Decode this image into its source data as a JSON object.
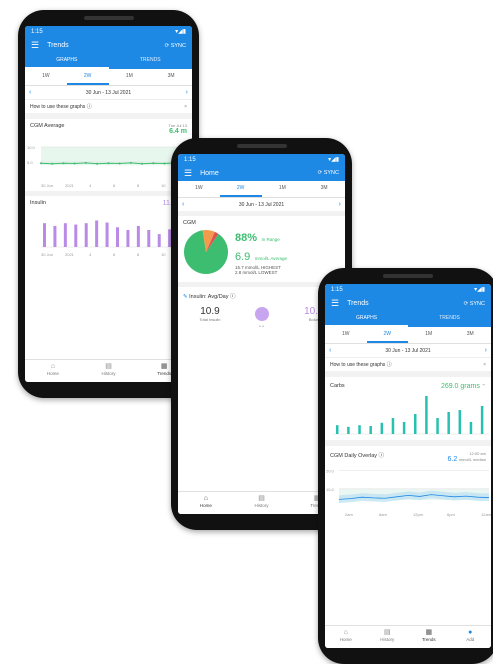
{
  "phone1": {
    "status_time": "1:15",
    "title": "Trends",
    "sync": "SYNC",
    "tabs": [
      "GRAPHS",
      "TRENDS"
    ],
    "ranges": [
      "1W",
      "2W",
      "1M",
      "3M"
    ],
    "date_range": "30 Jun - 13 Jul 2021",
    "howto": "How to use these graphs",
    "cgm_label": "CGM Average",
    "cgm_date": "Tue Jul 13",
    "cgm_value": "6.4 m",
    "insulin_label": "Insulin",
    "insulin_value": "11.1 uni",
    "cgm_y_labels": [
      "10.0",
      "5.0"
    ],
    "cgm_x_labels": [
      "30 Jun",
      "2021",
      "4",
      "6",
      "8",
      "10"
    ],
    "insulin_x_labels": [
      "30 Jun",
      "2021",
      "4",
      "6",
      "8",
      "10"
    ],
    "insulin_bars": [
      0.7,
      0.62,
      0.7,
      0.66,
      0.7,
      0.78,
      0.72,
      0.58,
      0.5,
      0.62,
      0.5,
      0.38,
      0.52,
      0.62
    ],
    "cgm_line": [
      4.6,
      4.4,
      4.6,
      4.5,
      4.7,
      4.4,
      4.6,
      4.5,
      4.7,
      4.4,
      4.6,
      4.5,
      4.7,
      4.5
    ],
    "nav": [
      "Home",
      "History",
      "Trends"
    ]
  },
  "phone2": {
    "status_time": "1:15",
    "title": "Home",
    "sync": "SYNC",
    "ranges": [
      "1W",
      "2W",
      "1M",
      "3M"
    ],
    "date_range": "30 Jun - 13 Jul 2021",
    "cgm_label": "CGM",
    "in_range_value": "88%",
    "in_range_label": "In Range",
    "average_value": "6.9",
    "average_label": "mmol/L Average",
    "highest": "15.7 mmol/L HIGHEST",
    "lowest": "2.8 mmol/L LOWEST",
    "cgm_pie": {
      "in_range": 0.88,
      "high": 0.09,
      "low": 0.03
    },
    "insulin_label": "Insulin: Avg/Day",
    "total_value": "10.9",
    "total_label": "Total Insulin",
    "bolus_value": "10.9",
    "bolus_label": "Bolus",
    "nav": [
      "Home",
      "History",
      "Trends"
    ]
  },
  "phone3": {
    "status_time": "1:15",
    "title": "Trends",
    "sync": "SYNC",
    "tabs": [
      "GRAPHS",
      "TRENDS"
    ],
    "ranges": [
      "1W",
      "2W",
      "1M",
      "3M"
    ],
    "date_range": "30 Jun - 13 Jul 2021",
    "howto": "How to use these graphs",
    "carbs_label": "Carbs",
    "carbs_value": "269.0 grams",
    "carbs_bars": [
      0.22,
      0.18,
      0.22,
      0.2,
      0.28,
      0.4,
      0.3,
      0.5,
      0.95,
      0.4,
      0.55,
      0.6,
      0.3,
      0.7
    ],
    "overlay_label": "CGM Daily Overlay",
    "overlay_time": "12:00 am",
    "overlay_value": "6.2",
    "overlay_unit": "mmol/L median",
    "overlay_y_labels": [
      "20.0",
      "10.0"
    ],
    "overlay_x_labels": [
      "2am",
      "6am",
      "12pm",
      "6pm",
      "12am"
    ],
    "overlay_line": [
      4.2,
      4.6,
      5.4,
      5.0,
      4.8,
      5.6,
      6.4,
      5.8,
      6.8,
      6.2,
      5.6,
      6.0,
      5.4,
      5.2
    ],
    "nav": [
      "Home",
      "History",
      "Trends",
      "Add"
    ]
  },
  "colors": {
    "primary": "#1e88e5",
    "green": "#3dbd6f",
    "purple": "#b98be6",
    "teal": "#26c1b0",
    "orange": "#f39a4c",
    "red": "#e05252"
  }
}
